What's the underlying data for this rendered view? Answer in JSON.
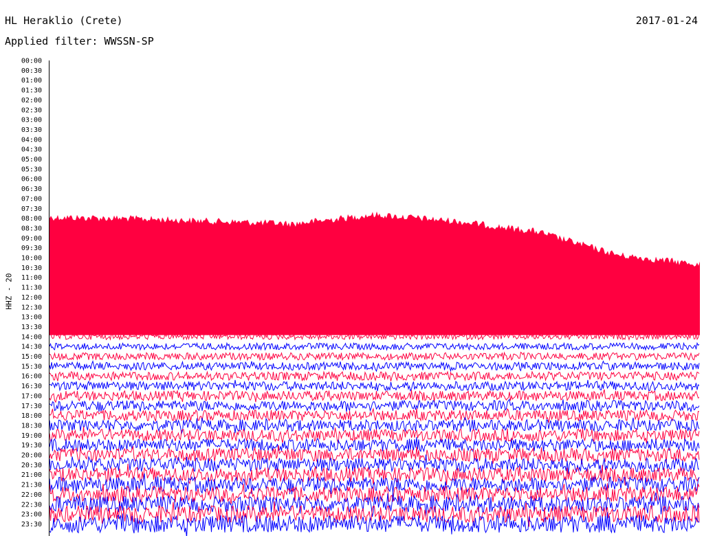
{
  "header": {
    "station": "HL Heraklio (Crete)",
    "date": "2017-01-24",
    "filter_label": "Applied filter: WWSSN-SP",
    "channel": "HHZ - 20"
  },
  "colors": {
    "trace_a": "#ff0040",
    "trace_b": "#0000ff",
    "background": "#ffffff",
    "text": "#000000"
  },
  "chart_data": {
    "type": "line",
    "title": "HL Heraklio (Crete)",
    "subtitle": "Applied filter: WWSSN-SP",
    "date": "2017-01-24",
    "ylabel": "HHZ - 20",
    "y_ticks": [
      "00:00",
      "00:30",
      "01:00",
      "01:30",
      "02:00",
      "02:30",
      "03:00",
      "03:30",
      "04:00",
      "04:30",
      "05:00",
      "05:30",
      "06:00",
      "06:30",
      "07:00",
      "07:30",
      "08:00",
      "08:30",
      "09:00",
      "09:30",
      "10:00",
      "10:30",
      "11:00",
      "11:30",
      "12:00",
      "12:30",
      "13:00",
      "13:30",
      "14:00",
      "14:30",
      "15:00",
      "15:30",
      "16:00",
      "16:30",
      "17:00",
      "17:30",
      "18:00",
      "18:30",
      "19:00",
      "19:30",
      "20:00",
      "20:30",
      "21:00",
      "21:30",
      "22:00",
      "22:30",
      "23:00",
      "23:30"
    ],
    "trace_colors": [
      "#ff0040",
      "#0000ff"
    ],
    "saturated_until": "13:30",
    "saturated_top_profile": [
      0.225,
      0.22,
      0.21,
      0.2,
      0.235,
      0.21,
      0.17,
      0.08,
      0.045
    ]
  }
}
